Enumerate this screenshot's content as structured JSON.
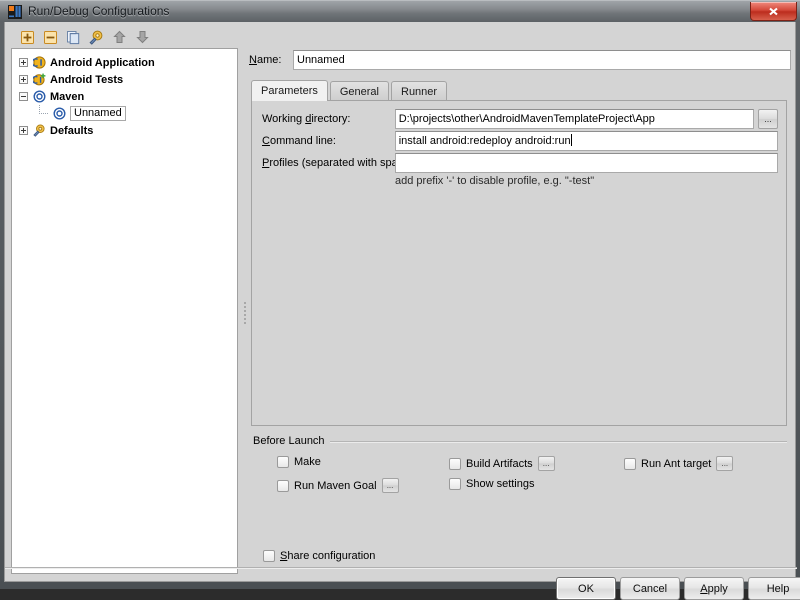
{
  "window": {
    "title": "Run/Debug Configurations",
    "app_icon": "intellij-idea-icon",
    "close_label": "Close"
  },
  "tree_toolbar": {
    "buttons": [
      {
        "name": "add-configuration-button",
        "icon": "plus-icon",
        "tooltip": "Add New Configuration"
      },
      {
        "name": "remove-configuration-button",
        "icon": "minus-icon",
        "tooltip": "Remove Configuration"
      },
      {
        "name": "copy-configuration-button",
        "icon": "copy-icon",
        "tooltip": "Copy Configuration"
      },
      {
        "name": "edit-defaults-button",
        "icon": "wrench-icon",
        "tooltip": "Edit defaults"
      },
      {
        "name": "move-up-button",
        "icon": "arrow-up-icon",
        "tooltip": "Move Up"
      },
      {
        "name": "move-down-button",
        "icon": "arrow-down-icon",
        "tooltip": "Move Down"
      }
    ]
  },
  "tree": {
    "nodes": [
      {
        "label": "Android Application",
        "icon": "android-application-icon",
        "indent": 0,
        "expander": "plus",
        "bold": true,
        "selected": false
      },
      {
        "label": "Android Tests",
        "icon": "android-tests-icon",
        "indent": 0,
        "expander": "plus",
        "bold": true,
        "selected": false
      },
      {
        "label": "Maven",
        "icon": "maven-icon",
        "indent": 0,
        "expander": "minus",
        "bold": true,
        "selected": false
      },
      {
        "label": "Unnamed",
        "icon": "maven-config-icon",
        "indent": 1,
        "expander": "none",
        "bold": false,
        "selected": true
      },
      {
        "label": "Defaults",
        "icon": "defaults-icon",
        "indent": 0,
        "expander": "plus",
        "bold": true,
        "selected": false
      }
    ]
  },
  "name_field": {
    "label": "Name:",
    "label_mnemonic": "N",
    "value": "Unnamed",
    "placeholder": ""
  },
  "tabs": [
    {
      "label": "Parameters",
      "active": true
    },
    {
      "label": "General",
      "active": false
    },
    {
      "label": "Runner",
      "active": false
    }
  ],
  "parameters": {
    "working_directory": {
      "label_prefix": "Working ",
      "label_mnemonic": "d",
      "label_suffix": "irectory:",
      "value": "D:\\projects\\other\\AndroidMavenTemplateProject\\App",
      "browse_button": "..."
    },
    "command_line": {
      "label_mnemonic": "C",
      "label_suffix": "ommand line:",
      "value": "install android:redeploy android:run"
    },
    "profiles": {
      "label_mnemonic": "P",
      "label_suffix": "rofiles (separated with space):",
      "value": "",
      "hint": "add prefix '-' to disable profile, e.g. \"-test\""
    }
  },
  "before_launch": {
    "title": "Before Launch",
    "items": [
      {
        "label": "Make",
        "checked": false,
        "has_dots": false,
        "col": 0,
        "row": 0
      },
      {
        "label": "Run Maven Goal",
        "checked": false,
        "has_dots": true,
        "col": 0,
        "row": 1
      },
      {
        "label": "Build Artifacts",
        "checked": false,
        "has_dots": true,
        "col": 1,
        "row": 0
      },
      {
        "label": "Show settings",
        "checked": false,
        "has_dots": false,
        "col": 1,
        "row": 1
      },
      {
        "label": "Run Ant target",
        "checked": false,
        "has_dots": true,
        "col": 2,
        "row": 0
      }
    ],
    "dots_label": "..."
  },
  "share_configuration": {
    "label_mnemonic": "S",
    "label_suffix": "hare configuration",
    "checked": false
  },
  "footer_buttons": [
    {
      "label": "OK",
      "name": "ok-button",
      "default": true,
      "mnemonic": ""
    },
    {
      "label": "Cancel",
      "name": "cancel-button",
      "default": false,
      "mnemonic": ""
    },
    {
      "label": "Apply",
      "name": "apply-button",
      "default": false,
      "mnemonic": "A"
    },
    {
      "label": "Help",
      "name": "help-button",
      "default": false,
      "mnemonic": ""
    }
  ],
  "colors": {
    "dialog_background": "#d4d4d4",
    "field_background": "#ffffff",
    "tree_background": "#ffffff",
    "close_button": "#c9392a",
    "accent_orange": "#f07b1a",
    "accent_blue": "#2a5caa"
  }
}
